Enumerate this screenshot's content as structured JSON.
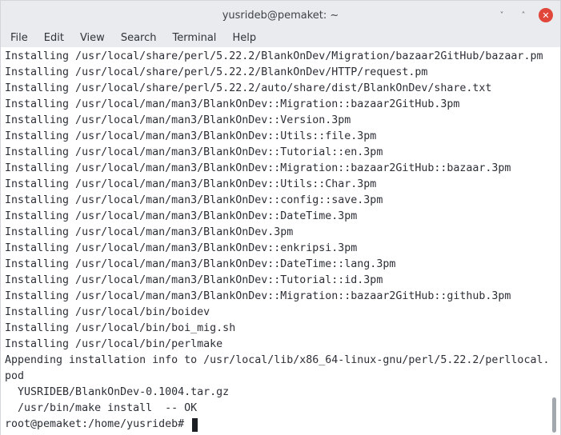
{
  "window": {
    "title": "yusrideb@pemaket: ~",
    "minimize_glyph": "˅",
    "maximize_glyph": "˄",
    "close_glyph": "✕"
  },
  "menubar": {
    "items": [
      "File",
      "Edit",
      "View",
      "Search",
      "Terminal",
      "Help"
    ]
  },
  "terminal": {
    "lines": [
      "Installing /usr/local/share/perl/5.22.2/BlankOnDev/Migration/bazaar2GitHub/bazaar.pm",
      "Installing /usr/local/share/perl/5.22.2/BlankOnDev/HTTP/request.pm",
      "Installing /usr/local/share/perl/5.22.2/auto/share/dist/BlankOnDev/share.txt",
      "Installing /usr/local/man/man3/BlankOnDev::Migration::bazaar2GitHub.3pm",
      "Installing /usr/local/man/man3/BlankOnDev::Version.3pm",
      "Installing /usr/local/man/man3/BlankOnDev::Utils::file.3pm",
      "Installing /usr/local/man/man3/BlankOnDev::Tutorial::en.3pm",
      "Installing /usr/local/man/man3/BlankOnDev::Migration::bazaar2GitHub::bazaar.3pm",
      "Installing /usr/local/man/man3/BlankOnDev::Utils::Char.3pm",
      "Installing /usr/local/man/man3/BlankOnDev::config::save.3pm",
      "Installing /usr/local/man/man3/BlankOnDev::DateTime.3pm",
      "Installing /usr/local/man/man3/BlankOnDev.3pm",
      "Installing /usr/local/man/man3/BlankOnDev::enkripsi.3pm",
      "Installing /usr/local/man/man3/BlankOnDev::DateTime::lang.3pm",
      "Installing /usr/local/man/man3/BlankOnDev::Tutorial::id.3pm",
      "Installing /usr/local/man/man3/BlankOnDev::Migration::bazaar2GitHub::github.3pm",
      "Installing /usr/local/bin/boidev",
      "Installing /usr/local/bin/boi_mig.sh",
      "Installing /usr/local/bin/perlmake",
      "Appending installation info to /usr/local/lib/x86_64-linux-gnu/perl/5.22.2/perllocal.",
      "pod",
      "  YUSRIDEB/BlankOnDev-0.1004.tar.gz",
      "  /usr/bin/make install  -- OK"
    ],
    "prompt": "root@pemaket:/home/yusrideb# "
  },
  "colors": {
    "titlebar_bg": "#e9ebee",
    "close_button": "#e0463a",
    "terminal_bg": "#ffffff",
    "terminal_text": "#2b2f36"
  }
}
